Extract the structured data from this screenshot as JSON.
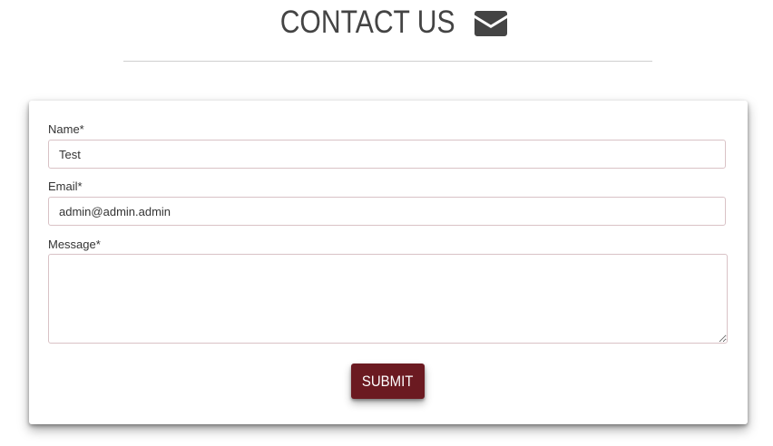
{
  "header": {
    "title": "CONTACT US",
    "icon": "envelope-icon",
    "title_color": "#444444"
  },
  "form": {
    "name": {
      "label": "Name*",
      "value": "Test"
    },
    "email": {
      "label": "Email*",
      "value": "admin@admin.admin"
    },
    "message": {
      "label": "Message*",
      "value": ""
    },
    "submit_label": "SUBMIT",
    "submit_color": "#6b1a21",
    "input_border_color": "#d9c2c6"
  }
}
